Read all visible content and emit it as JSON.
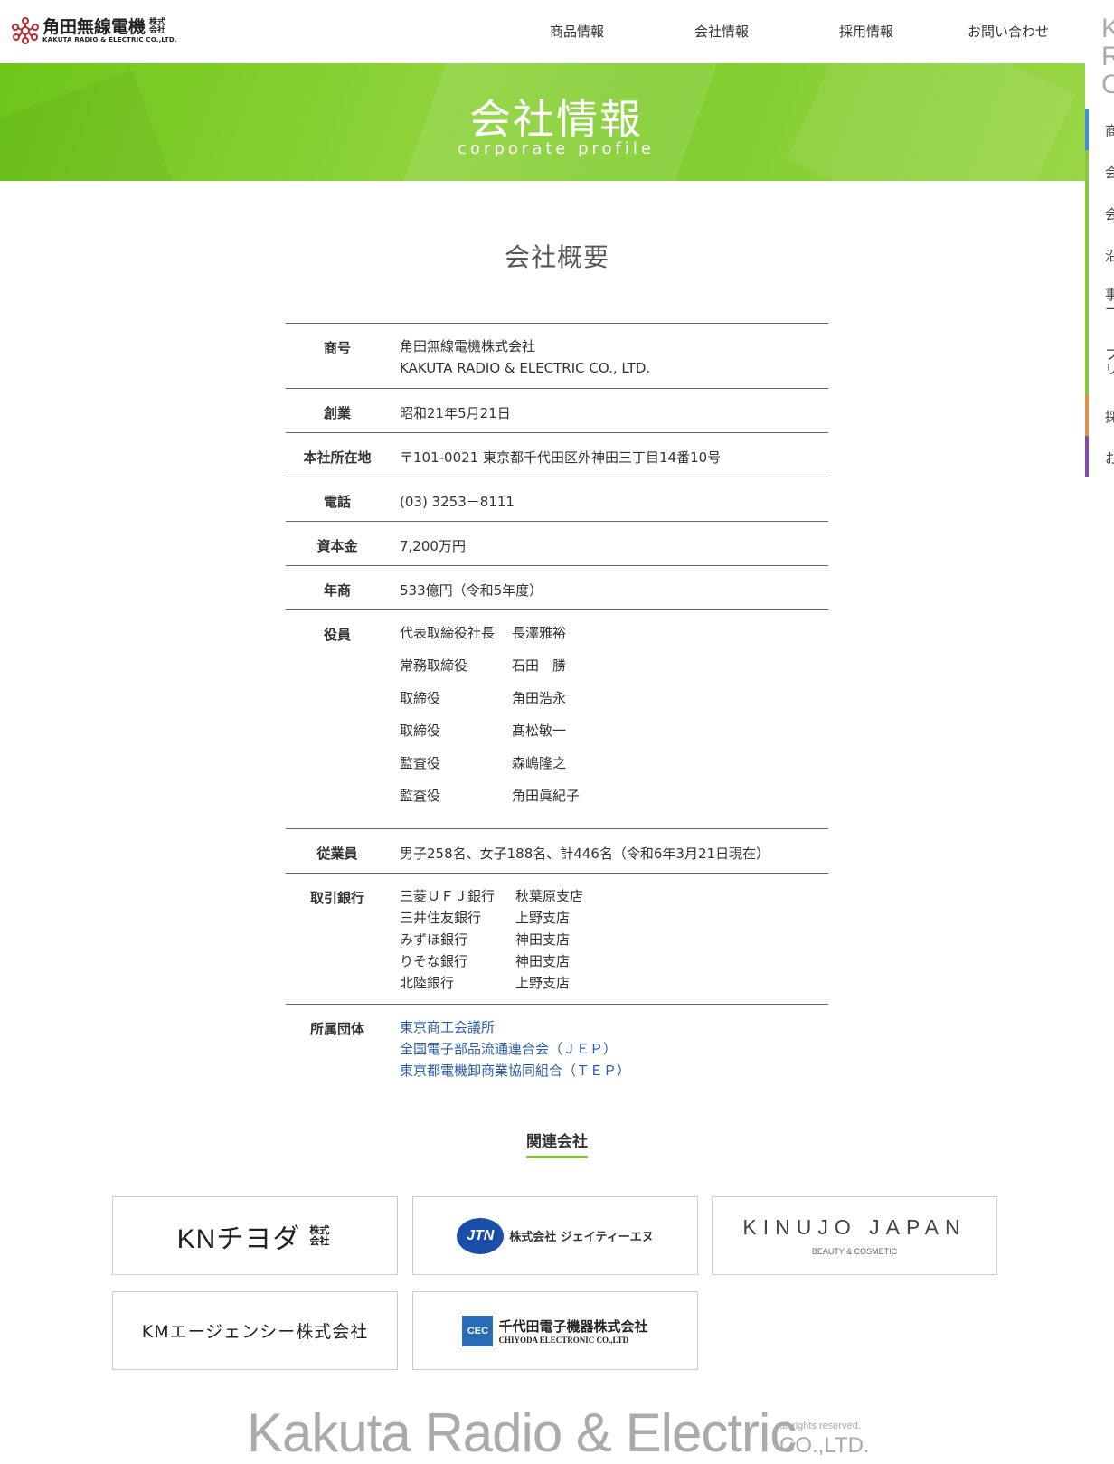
{
  "header": {
    "logo_jp": "角田無線電機",
    "logo_kabu": "株式会社",
    "logo_en": "KAKUTA RADIO & ELECTRIC CO.,LTD.",
    "nav": [
      "商品情報",
      "会社情報",
      "採用情報",
      "お問い合わせ"
    ]
  },
  "side": {
    "title": "K R C",
    "items": [
      {
        "label": "商",
        "color": "#3d8fd9"
      },
      {
        "label": "会",
        "color": "#8cc63f"
      },
      {
        "label": "会",
        "color": "#8cc63f"
      },
      {
        "label": "沿",
        "color": "#8cc63f"
      },
      {
        "label": "事 ー",
        "color": "#8cc63f"
      },
      {
        "label": "フ リ",
        "color": "#8cc63f"
      },
      {
        "label": "採",
        "color": "#e0914a"
      },
      {
        "label": "お",
        "color": "#7a4fa5"
      }
    ]
  },
  "hero": {
    "title": "会社情報",
    "subtitle": "corporate profile"
  },
  "section_title": "会社概要",
  "profile": {
    "trade_name": {
      "label": "商号",
      "line1": "角田無線電機株式会社",
      "line2": "KAKUTA RADIO & ELECTRIC CO., LTD."
    },
    "founded": {
      "label": "創業",
      "value": "昭和21年5月21日"
    },
    "address": {
      "label": "本社所在地",
      "value": "〒101-0021 東京都千代田区外神田三丁目14番10号"
    },
    "phone": {
      "label": "電話",
      "value": "(03) 3253－8111"
    },
    "capital": {
      "label": "資本金",
      "value": "7,200万円"
    },
    "sales": {
      "label": "年商",
      "value": "533億円（令和5年度）"
    },
    "officers": {
      "label": "役員",
      "list": [
        {
          "role": "代表取締役社長",
          "name": "長澤雅裕"
        },
        {
          "role": "常務取締役",
          "name": "石田　勝"
        },
        {
          "role": "取締役",
          "name": "角田浩永"
        },
        {
          "role": "取締役",
          "name": "髙松敏一"
        },
        {
          "role": "監査役",
          "name": "森嶋隆之"
        },
        {
          "role": "監査役",
          "name": "角田眞紀子"
        }
      ]
    },
    "employees": {
      "label": "従業員",
      "value": "男子258名、女子188名、計446名（令和6年3月21日現在）"
    },
    "banks": {
      "label": "取引銀行",
      "list": [
        {
          "bank": "三菱ＵＦＪ銀行",
          "branch": "秋葉原支店"
        },
        {
          "bank": "三井住友銀行",
          "branch": "上野支店"
        },
        {
          "bank": "みずほ銀行",
          "branch": "神田支店"
        },
        {
          "bank": "りそな銀行",
          "branch": "神田支店"
        },
        {
          "bank": "北陸銀行",
          "branch": "上野支店"
        }
      ]
    },
    "associations": {
      "label": "所属団体",
      "list": [
        "東京商工会議所",
        "全国電子部品流通連合会（ＪＥＰ）",
        "東京都電機卸商業協同組合（ＴＥＰ）"
      ]
    }
  },
  "related": {
    "title": "関連会社",
    "companies": [
      {
        "name": "KNチヨダ",
        "suffix": "株式会社"
      },
      {
        "name": "株式会社 ジェイティーエヌ",
        "logo": "JTN"
      },
      {
        "name": "KINUJO JAPAN",
        "sub": "BEAUTY & COSMETIC"
      },
      {
        "name": "KMエージェンシー株式会社"
      },
      {
        "name": "千代田電子機器株式会社",
        "sub": "CHIYODA ELECTRONIC CO.,LTD",
        "logo": "CEC"
      }
    ]
  },
  "footer": {
    "brand": "Kakuta Radio & Electric",
    "rights": "all rights reserved.",
    "co": "CO.,LTD."
  }
}
